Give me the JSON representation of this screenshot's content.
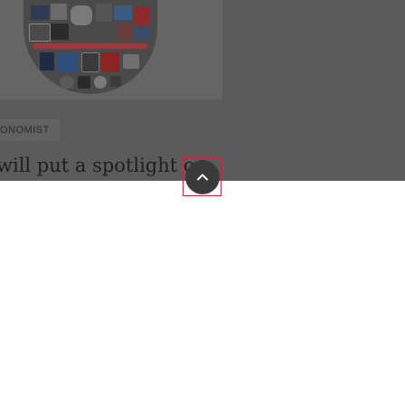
{
  "article_card": {
    "section_label": "ONOMIST",
    "headline": "will put a spotlight on",
    "image_icon": "mosaic-illustration-icon"
  },
  "scroll_to_top": {
    "icon": "chevron-up-icon",
    "accent_color": "#d2232a",
    "button_color": "#3a3a3a"
  },
  "colors": {
    "scrim": "#5b5b5b",
    "background": "#ffffff"
  }
}
